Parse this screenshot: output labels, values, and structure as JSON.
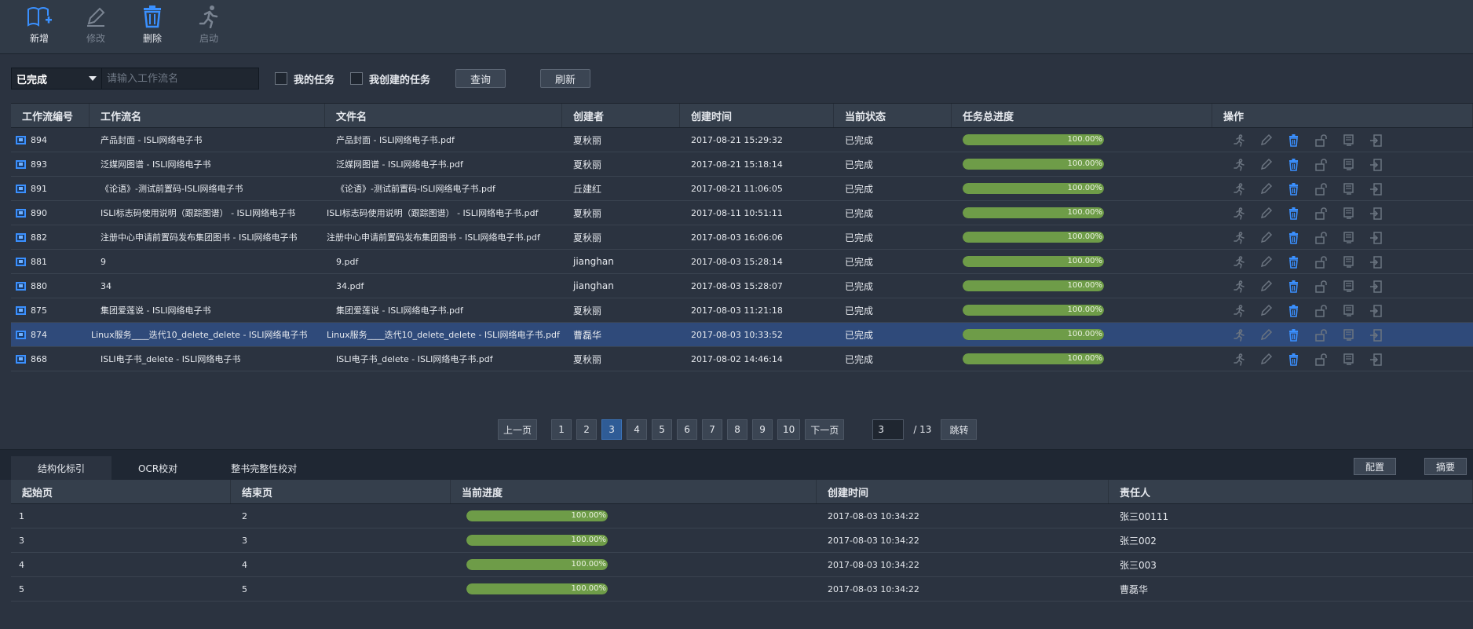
{
  "toolbar": {
    "add": "新增",
    "edit": "修改",
    "delete": "删除",
    "start": "启动"
  },
  "filter": {
    "status_value": "已完成",
    "workflow_placeholder": "请输入工作流名",
    "my_tasks": "我的任务",
    "my_created_tasks": "我创建的任务",
    "query": "查询",
    "refresh": "刷新"
  },
  "table": {
    "headers": [
      "工作流编号",
      "工作流名",
      "文件名",
      "创建者",
      "创建时间",
      "当前状态",
      "任务总进度",
      "操作"
    ],
    "rows": [
      {
        "id": "894",
        "name": "产品封面 - ISLI网络电子书",
        "file": "产品封面 - ISLI网络电子书.pdf",
        "creator": "夏秋丽",
        "time": "2017-08-21 15:29:32",
        "status": "已完成",
        "progress": "100.00%"
      },
      {
        "id": "893",
        "name": "泛媒网图谱 - ISLI网络电子书",
        "file": "泛媒网图谱 - ISLI网络电子书.pdf",
        "creator": "夏秋丽",
        "time": "2017-08-21 15:18:14",
        "status": "已完成",
        "progress": "100.00%"
      },
      {
        "id": "891",
        "name": "《论语》-测试前置码-ISLI网络电子书",
        "file": "《论语》-测试前置码-ISLI网络电子书.pdf",
        "creator": "丘建红",
        "time": "2017-08-21 11:06:05",
        "status": "已完成",
        "progress": "100.00%"
      },
      {
        "id": "890",
        "name": "ISLI标志码使用说明（跟踪图谱） - ISLI网络电子书",
        "file": "ISLI标志码使用说明（跟踪图谱） - ISLI网络电子书.pdf",
        "creator": "夏秋丽",
        "time": "2017-08-11 10:51:11",
        "status": "已完成",
        "progress": "100.00%"
      },
      {
        "id": "882",
        "name": "注册中心申请前置码发布集团图书 - ISLI网络电子书",
        "file": "注册中心申请前置码发布集团图书 - ISLI网络电子书.pdf",
        "creator": "夏秋丽",
        "time": "2017-08-03 16:06:06",
        "status": "已完成",
        "progress": "100.00%"
      },
      {
        "id": "881",
        "name": "9",
        "file": "9.pdf",
        "creator": "jianghan",
        "time": "2017-08-03 15:28:14",
        "status": "已完成",
        "progress": "100.00%"
      },
      {
        "id": "880",
        "name": "34",
        "file": "34.pdf",
        "creator": "jianghan",
        "time": "2017-08-03 15:28:07",
        "status": "已完成",
        "progress": "100.00%"
      },
      {
        "id": "875",
        "name": "集团爱莲说 - ISLI网络电子书",
        "file": "集团爱莲说 - ISLI网络电子书.pdf",
        "creator": "夏秋丽",
        "time": "2017-08-03 11:21:18",
        "status": "已完成",
        "progress": "100.00%"
      },
      {
        "id": "874",
        "name": "Linux服务____迭代10_delete_delete - ISLI网络电子书",
        "file": "Linux服务____迭代10_delete_delete - ISLI网络电子书.pdf",
        "creator": "曹磊华",
        "time": "2017-08-03 10:33:52",
        "status": "已完成",
        "progress": "100.00%"
      },
      {
        "id": "868",
        "name": "ISLI电子书_delete - ISLI网络电子书",
        "file": "ISLI电子书_delete - ISLI网络电子书.pdf",
        "creator": "夏秋丽",
        "time": "2017-08-02 14:46:14",
        "status": "已完成",
        "progress": "100.00%"
      }
    ]
  },
  "pager": {
    "prev": "上一页",
    "pages": [
      "1",
      "2",
      "3",
      "4",
      "5",
      "6",
      "7",
      "8",
      "9",
      "10"
    ],
    "next": "下一页",
    "current": "3",
    "total": "/ 13",
    "jump": "跳转"
  },
  "tabs": {
    "items": [
      "结构化标引",
      "OCR校对",
      "整书完整性校对"
    ],
    "config": "配置",
    "extra": "摘要"
  },
  "sub_table": {
    "headers": [
      "起始页",
      "结束页",
      "当前进度",
      "创建时间",
      "责任人"
    ],
    "rows": [
      {
        "start": "1",
        "end": "2",
        "progress": "100.00%",
        "time": "2017-08-03 10:34:22",
        "owner": "张三00111"
      },
      {
        "start": "3",
        "end": "3",
        "progress": "100.00%",
        "time": "2017-08-03 10:34:22",
        "owner": "张三002"
      },
      {
        "start": "4",
        "end": "4",
        "progress": "100.00%",
        "time": "2017-08-03 10:34:22",
        "owner": "张三003"
      },
      {
        "start": "5",
        "end": "5",
        "progress": "100.00%",
        "time": "2017-08-03 10:34:22",
        "owner": "曹磊华"
      }
    ]
  },
  "colors": {
    "accent": "#3a90ff",
    "progress_fill": "#6e9c48",
    "selected_row": "#2f4a7a"
  }
}
